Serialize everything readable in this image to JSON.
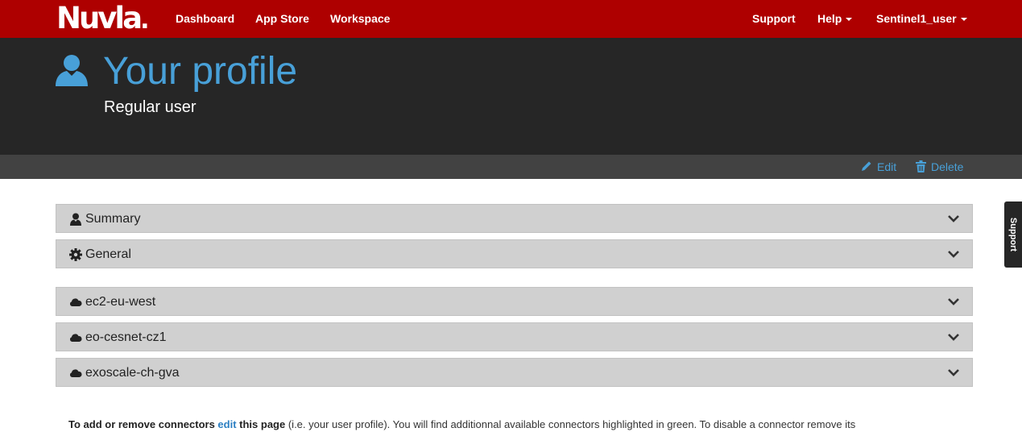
{
  "navbar": {
    "logo": "Nuvla",
    "links": [
      {
        "label": "Dashboard"
      },
      {
        "label": "App Store"
      },
      {
        "label": "Workspace"
      }
    ],
    "support": "Support",
    "help": "Help",
    "user": "Sentinel1_user"
  },
  "header": {
    "icon": "user-icon",
    "title": "Your profile",
    "subtitle": "Regular user"
  },
  "actions": {
    "edit": "Edit",
    "edit_icon": "pencil-icon",
    "delete": "Delete",
    "delete_icon": "trash-icon"
  },
  "panels": [
    {
      "icon": "user-icon",
      "label": "Summary"
    },
    {
      "icon": "gear-icon",
      "label": "General"
    },
    {
      "icon": "cloud-icon",
      "label": "ec2-eu-west"
    },
    {
      "icon": "cloud-icon",
      "label": "eo-cesnet-cz1"
    },
    {
      "icon": "cloud-icon",
      "label": "exoscale-ch-gva"
    }
  ],
  "support_tab": "Support",
  "info": {
    "part1": "To add or remove connectors ",
    "link": "edit",
    "part2": " this page",
    "part3": " (i.e. your user profile). You will find additionnal available connectors highlighted in green. To disable a connector remove its"
  },
  "colors": {
    "navbar": "#ae0000",
    "header": "#262626",
    "accent": "#48a0d8",
    "panel": "#d0d0d0"
  }
}
